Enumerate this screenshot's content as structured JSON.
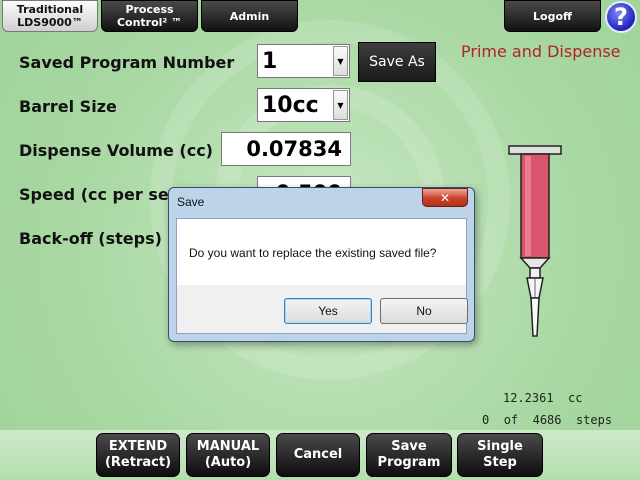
{
  "tabs": [
    {
      "line1": "Traditional",
      "line2": "LDS9000™",
      "active": true
    },
    {
      "line1": "Process",
      "line2": "Control² ™",
      "active": false
    },
    {
      "line1": "Admin",
      "line2": "",
      "active": false
    }
  ],
  "logoff_label": "Logoff",
  "help_glyph": "?",
  "mode_title": "Prime and Dispense",
  "form": {
    "saved_program_label": "Saved Program Number",
    "saved_program_value": "1",
    "save_as_label": "Save As",
    "barrel_size_label": "Barrel Size",
    "barrel_size_value": "10cc",
    "dispense_volume_label": "Dispense Volume (cc)",
    "dispense_volume_value": "0.07834",
    "speed_label": "Speed (cc per se",
    "speed_value": "0.500",
    "backoff_label": "Back-off (steps)"
  },
  "readouts": {
    "volume_value": "12.2361",
    "volume_unit": "cc",
    "step_current": "0",
    "step_of": "of",
    "step_total": "4686",
    "step_unit": "steps"
  },
  "bottom_buttons": [
    {
      "line1": "EXTEND",
      "line2": "(Retract)"
    },
    {
      "line1": "MANUAL",
      "line2": "(Auto)"
    },
    {
      "line1": "Cancel",
      "line2": ""
    },
    {
      "line1": "Save",
      "line2": "Program"
    },
    {
      "line1": "Single",
      "line2": "Step"
    }
  ],
  "dialog": {
    "title": "Save",
    "close_glyph": "✕",
    "message": "Do you want to replace the existing saved file?",
    "yes_label": "Yes",
    "no_label": "No"
  },
  "icons": {
    "dropdown": "chevron-down-icon",
    "syringe": "syringe-icon",
    "help": "help-icon"
  },
  "colors": {
    "background": "#a9d8a3",
    "mode_title": "#b02424",
    "syringe_barrel": "#d9556b",
    "help_button": "#1d23b8"
  }
}
